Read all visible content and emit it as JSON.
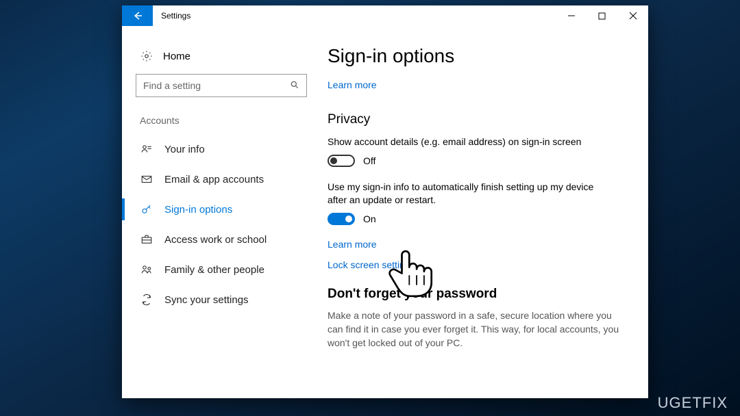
{
  "window": {
    "title": "Settings"
  },
  "sidebar": {
    "home": "Home",
    "search_placeholder": "Find a setting",
    "section": "Accounts",
    "items": [
      {
        "label": "Your info"
      },
      {
        "label": "Email & app accounts"
      },
      {
        "label": "Sign-in options"
      },
      {
        "label": "Access work or school"
      },
      {
        "label": "Family & other people"
      },
      {
        "label": "Sync your settings"
      }
    ],
    "active_index": 2
  },
  "content": {
    "title": "Sign-in options",
    "learn_more": "Learn more",
    "privacy_heading": "Privacy",
    "privacy_setting1_label": "Show account details (e.g. email address) on sign-in screen",
    "privacy_setting1_state": "Off",
    "privacy_setting2_label": "Use my sign-in info to automatically finish setting up my device after an update or restart.",
    "privacy_setting2_state": "On",
    "learn_more2": "Learn more",
    "lock_screen_link": "Lock screen settings",
    "forgot_heading": "Don't forget your password",
    "forgot_text": "Make a note of your password in a safe, secure location where you can find it in case you ever forget it. This way, for local accounts, you won't get locked out of your PC."
  },
  "watermark": "UGETFIX"
}
